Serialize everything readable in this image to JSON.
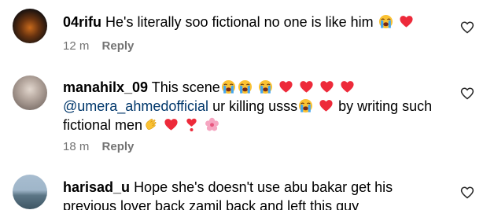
{
  "comments": [
    {
      "username": "04rifu",
      "text": "He's literally soo fictional no one is like him",
      "time": "12 m",
      "reply": "Reply"
    },
    {
      "username": "manahilx_09",
      "text1": "This scene",
      "mention": "@umera_ahmedofficial",
      "text2": "ur killing usss",
      "text3": "by writing such fictional men",
      "time": "18 m",
      "reply": "Reply"
    },
    {
      "username": "harisad_u",
      "text": "Hope she's doesn't use abu bakar get his previous lover back zamil back and left this guy"
    }
  ],
  "icons": {
    "like": "heart-outline-icon",
    "loudly_crying": "loudly-crying-face-icon",
    "red_heart": "red-heart-icon",
    "waving_hand": "waving-hand-icon",
    "exclamation_heart": "heart-exclamation-icon",
    "blossom": "cherry-blossom-icon"
  },
  "colors": {
    "mention": "#00376b",
    "meta": "#737373",
    "heart": "#ed2a3a"
  }
}
